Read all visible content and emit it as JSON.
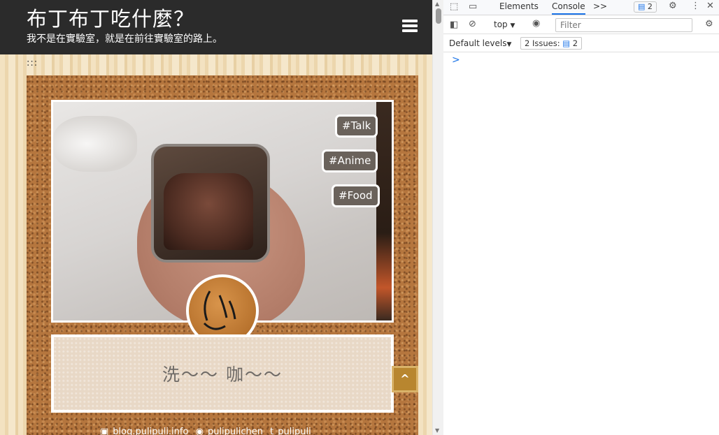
{
  "site": {
    "title": "布丁布丁吃什麼？",
    "subtitle": "我不是在實驗室，就是在前往實驗室的路上。",
    "breadcrumb_dots": ":::",
    "tags": [
      "#Talk",
      "#Anime",
      "#Food"
    ],
    "caption": "洗～～ 咖～～",
    "back_to_top_icon": "^",
    "footer": {
      "blog": "blog.pulipuli.info",
      "github": "pulipulichen",
      "tumblr": "pulipuli"
    },
    "colors": {
      "header_bg": "#2b2b2b",
      "tag_bg": "#6a625b",
      "cork": "#b5763e",
      "back_to_top": "#b8862f"
    }
  },
  "devtools": {
    "tabs": [
      "Elements",
      "Console"
    ],
    "active_tab": "Console",
    "more_tabs_icon": ">>",
    "messages_count": "2",
    "context": "top",
    "filter_placeholder": "Filter",
    "levels": "Default levels",
    "issues_label": "2 Issues:",
    "issues_count": "2",
    "prompt": ">"
  }
}
